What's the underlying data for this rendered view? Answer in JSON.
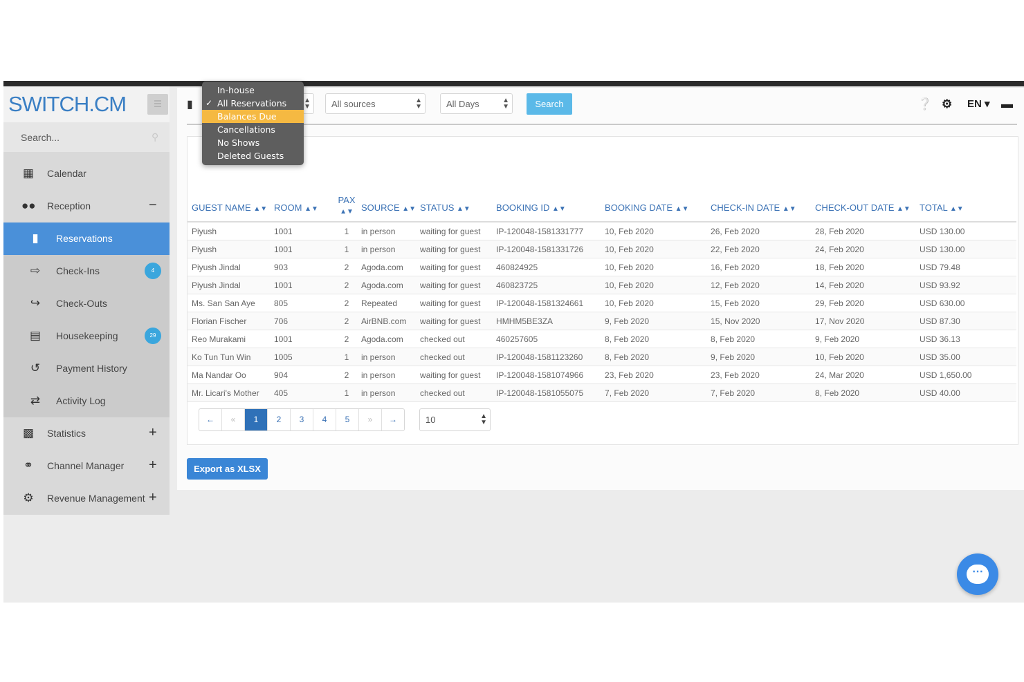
{
  "app": {
    "logo": "SWITCH.CM"
  },
  "sidebar": {
    "search_placeholder": "Search...",
    "items": [
      {
        "label": "Calendar",
        "icon": "calendar-icon"
      },
      {
        "label": "Reception",
        "icon": "users-icon",
        "toggle": "−"
      },
      {
        "label": "Reservations",
        "icon": "book-icon"
      },
      {
        "label": "Check-Ins",
        "icon": "sign-in-icon",
        "badge": "4"
      },
      {
        "label": "Check-Outs",
        "icon": "sign-out-icon"
      },
      {
        "label": "Housekeeping",
        "icon": "list-icon",
        "badge": "29"
      },
      {
        "label": "Payment History",
        "icon": "history-icon"
      },
      {
        "label": "Activity Log",
        "icon": "exchange-icon"
      },
      {
        "label": "Statistics",
        "icon": "bar-chart-icon",
        "toggle": "+"
      },
      {
        "label": "Channel Manager",
        "icon": "channel-icon",
        "toggle": "+"
      },
      {
        "label": "Revenue Management",
        "icon": "gear-icon",
        "toggle": "+"
      }
    ]
  },
  "toolbar": {
    "sources_select": "All sources",
    "days_select": "All Days",
    "search_label": "Search",
    "language": "EN"
  },
  "dropdown": {
    "items": [
      "In-house",
      "All Reservations",
      "Balances Due",
      "Cancellations",
      "No Shows",
      "Deleted Guests"
    ],
    "checked": "All Reservations",
    "highlighted": "Balances Due"
  },
  "table": {
    "headers": [
      "GUEST NAME",
      "ROOM",
      "PAX",
      "SOURCE",
      "STATUS",
      "BOOKING ID",
      "BOOKING DATE",
      "CHECK-IN DATE",
      "CHECK-OUT DATE",
      "TOTAL"
    ],
    "rows": [
      [
        "Piyush",
        "1001",
        "1",
        "in person",
        "waiting for guest",
        "IP-120048-1581331777",
        "10, Feb 2020",
        "26, Feb 2020",
        "28, Feb 2020",
        "USD 130.00"
      ],
      [
        "Piyush",
        "1001",
        "1",
        "in person",
        "waiting for guest",
        "IP-120048-1581331726",
        "10, Feb 2020",
        "22, Feb 2020",
        "24, Feb 2020",
        "USD 130.00"
      ],
      [
        "Piyush Jindal",
        "903",
        "2",
        "Agoda.com",
        "waiting for guest",
        "460824925",
        "10, Feb 2020",
        "16, Feb 2020",
        "18, Feb 2020",
        "USD 79.48"
      ],
      [
        "Piyush Jindal",
        "1001",
        "2",
        "Agoda.com",
        "waiting for guest",
        "460823725",
        "10, Feb 2020",
        "12, Feb 2020",
        "14, Feb 2020",
        "USD 93.92"
      ],
      [
        "Ms. San San Aye",
        "805",
        "2",
        "Repeated",
        "waiting for guest",
        "IP-120048-1581324661",
        "10, Feb 2020",
        "15, Feb 2020",
        "29, Feb 2020",
        "USD 630.00"
      ],
      [
        "Florian Fischer",
        "706",
        "2",
        "AirBNB.com",
        "waiting for guest",
        "HMHM5BE3ZA",
        "9, Feb 2020",
        "15, Nov 2020",
        "17, Nov 2020",
        "USD 87.30"
      ],
      [
        "Reo Murakami",
        "1001",
        "2",
        "Agoda.com",
        "checked out",
        "460257605",
        "8, Feb 2020",
        "8, Feb 2020",
        "9, Feb 2020",
        "USD 36.13"
      ],
      [
        "Ko Tun Tun Win",
        "1005",
        "1",
        "in person",
        "checked out",
        "IP-120048-1581123260",
        "8, Feb 2020",
        "9, Feb 2020",
        "10, Feb 2020",
        "USD 35.00"
      ],
      [
        "Ma Nandar Oo",
        "904",
        "2",
        "in person",
        "waiting for guest",
        "IP-120048-1581074966",
        "23, Feb 2020",
        "23, Feb 2020",
        "24, Mar 2020",
        "USD 1,650.00"
      ],
      [
        "Mr. Licari's Mother",
        "405",
        "1",
        "in person",
        "checked out",
        "IP-120048-1581055075",
        "7, Feb 2020",
        "7, Feb 2020",
        "8, Feb 2020",
        "USD 40.00"
      ]
    ]
  },
  "pagination": {
    "prev": "←",
    "first": "«",
    "pages": [
      "1",
      "2",
      "3",
      "4",
      "5"
    ],
    "last": "»",
    "next": "→",
    "current": "1",
    "per_page": "10"
  },
  "export_label": "Export as XLSX",
  "colors": {
    "brand": "#3a7fc4",
    "active_nav": "#4a90d9",
    "highlight": "#f5b942",
    "search_button": "#5bb9e8"
  }
}
